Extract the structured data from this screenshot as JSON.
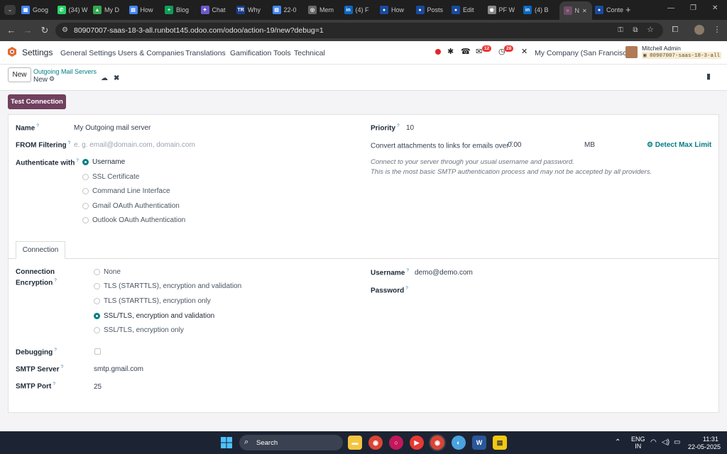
{
  "browser": {
    "tabs": [
      {
        "label": "Goog",
        "color": "#4285f4",
        "glyph": "▦"
      },
      {
        "label": "(34) W",
        "color": "#25d366",
        "glyph": "✆"
      },
      {
        "label": "My D",
        "color": "#34a853",
        "glyph": "▲"
      },
      {
        "label": "How",
        "color": "#4285f4",
        "glyph": "▤"
      },
      {
        "label": "Blog",
        "color": "#0f9d58",
        "glyph": "+"
      },
      {
        "label": "Chat",
        "color": "#6a5acd",
        "glyph": "✦"
      },
      {
        "label": "Why",
        "color": "#1a3e8c",
        "glyph": "TR"
      },
      {
        "label": "22-0",
        "color": "#4285f4",
        "glyph": "▤"
      },
      {
        "label": "Mem",
        "color": "#666666",
        "glyph": "◎"
      },
      {
        "label": "(4) F",
        "color": "#0a66c2",
        "glyph": "in"
      },
      {
        "label": "How",
        "color": "#1a4a9c",
        "glyph": "●"
      },
      {
        "label": "Posts",
        "color": "#1a4a9c",
        "glyph": "●"
      },
      {
        "label": "Edit",
        "color": "#1a4a9c",
        "glyph": "●"
      },
      {
        "label": "PF W",
        "color": "#888888",
        "glyph": "◉"
      },
      {
        "label": "(4) B",
        "color": "#0a66c2",
        "glyph": "in"
      },
      {
        "label": "N",
        "color": "#714b67",
        "glyph": "○"
      },
      {
        "label": "Conte",
        "color": "#1a4a9c",
        "glyph": "●"
      }
    ],
    "new_tab": "+",
    "window_controls": [
      "—",
      "❐",
      "✕"
    ],
    "url": "80907007-saas-18-3-all.runbot145.odoo.com/odoo/action-19/new?debug=1"
  },
  "navbar": {
    "app_name": "Settings",
    "menus": [
      "General Settings",
      "Users & Companies",
      "Translations",
      "Gamification Tools",
      "Technical"
    ],
    "messages_count": "12",
    "activities_count": "28",
    "company": "My Company (San Francisco)",
    "user_name": "Mitchell Admin",
    "db_name": "80907007-saas-18-3-all"
  },
  "control_panel": {
    "new_button": "New",
    "breadcrumb_parent": "Outgoing Mail Servers",
    "breadcrumb_current": "New"
  },
  "actions": {
    "test_connection": "Test Connection"
  },
  "form": {
    "name_label": "Name",
    "name_value": "My Outgoing mail server",
    "from_filter_label": "FROM Filtering",
    "from_filter_placeholder": "e. g. email@domain.com, domain.com",
    "auth_label": "Authenticate with",
    "auth_options": [
      "Username",
      "SSL Certificate",
      "Command Line Interface",
      "Gmail OAuth Authentication",
      "Outlook OAuth Authentication"
    ],
    "auth_selected": 0,
    "priority_label": "Priority",
    "priority_value": "10",
    "attach_label": "Convert attachments to links for emails over",
    "attach_value": "0.00",
    "attach_unit": "MB",
    "detect_max_limit": "Detect Max Limit",
    "hint_line1": "Connect to your server through your usual username and password.",
    "hint_line2": "This is the most basic SMTP authentication process and may not be accepted by all providers.",
    "connection_tab": "Connection",
    "encryption_label_1": "Connection",
    "encryption_label_2": "Encryption",
    "encryption_options": [
      "None",
      "TLS (STARTTLS), encryption and validation",
      "TLS (STARTTLS), encryption only",
      "SSL/TLS, encryption and validation",
      "SSL/TLS, encryption only"
    ],
    "encryption_selected": 3,
    "username_label": "Username",
    "username_value": "demo@demo.com",
    "password_label": "Password",
    "debugging_label": "Debugging",
    "debugging_checked": false,
    "smtp_server_label": "SMTP Server",
    "smtp_server_value": "smtp.gmail.com",
    "smtp_port_label": "SMTP Port",
    "smtp_port_value": "25",
    "help_mark": "?"
  },
  "taskbar": {
    "search_label": "Search",
    "lang_line1": "ENG",
    "lang_line2": "IN",
    "time": "11:31",
    "date": "22-05-2025"
  },
  "colors": {
    "brand": "#71405f",
    "accent": "#017e84",
    "link": "#2b7aa8"
  }
}
